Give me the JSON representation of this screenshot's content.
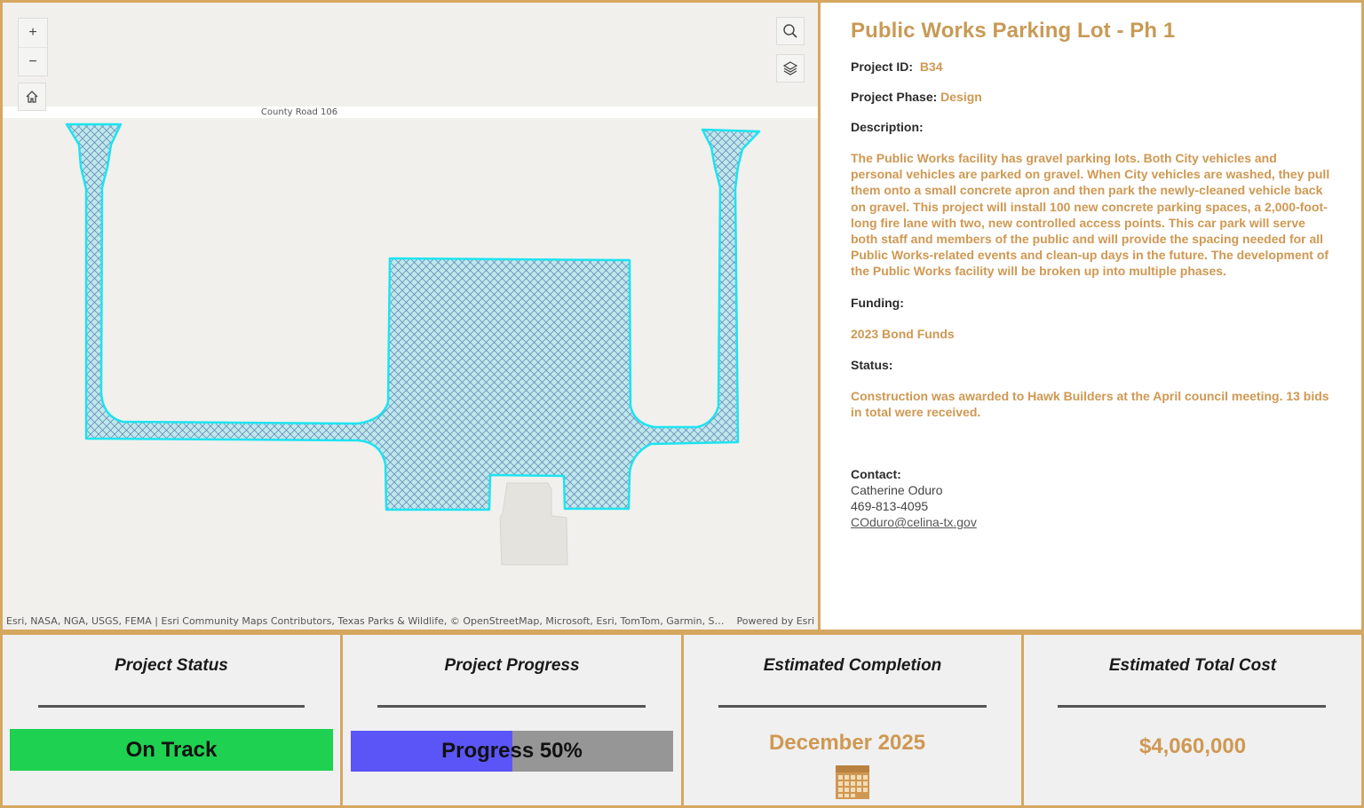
{
  "map": {
    "road_label": "County Road 106",
    "attribution": "Esri, NASA, NGA, USGS, FEMA | Esri Community Maps Contributors, Texas Parks & Wildlife, © OpenStreetMap, Microsoft, Esri, TomTom, Garmin, Saf…",
    "powered_by": "Powered by Esri",
    "controls": {
      "zoom_in": "+",
      "zoom_out": "−",
      "home_icon": "home-icon",
      "search_icon": "search-icon",
      "layers_icon": "layers-icon"
    },
    "feature_fill_color": "#00e5ee"
  },
  "project": {
    "title": "Public Works Parking Lot - Ph 1",
    "id_label": "Project ID:",
    "id_value": "B34",
    "phase_label": "Project Phase:",
    "phase_value": "Design",
    "description_label": "Description:",
    "description": "The Public Works facility has gravel parking lots. Both City vehicles and personal vehicles are parked on gravel. When City vehicles are washed, they pull them onto a small concrete apron and then park the newly-cleaned vehicle back on gravel. This project will install 100 new concrete parking spaces, a 2,000-foot-long fire lane with two, new controlled access points. This car park will serve both staff and members of the public and will provide the spacing needed for all Public Works-related events and clean-up days in the future. The development of the Public Works facility will be broken up into multiple phases.",
    "funding_label": "Funding:",
    "funding_value": "2023 Bond Funds",
    "status_label": "Status:",
    "status_value": "Construction was awarded to Hawk Builders at the April council meeting. 13 bids in total were received.",
    "contact_label": "Contact:",
    "contact_name": "Catherine Oduro",
    "contact_phone": "469-813-4095",
    "contact_email": "COduro@celina-tx.gov"
  },
  "cards": {
    "status": {
      "title": "Project Status",
      "value": "On Track",
      "color": "#1ed150"
    },
    "progress": {
      "title": "Project Progress",
      "label": "Progress 50%",
      "fraction": 0.5,
      "fill_color": "#5b55f7",
      "track_color": "#969696"
    },
    "completion": {
      "title": "Estimated Completion",
      "value": "December 2025",
      "icon": "calendar-icon"
    },
    "cost": {
      "title": "Estimated Total Cost",
      "value": "$4,060,000"
    }
  },
  "colors": {
    "accent": "#d6a760",
    "text_accent": "#cf9852"
  }
}
